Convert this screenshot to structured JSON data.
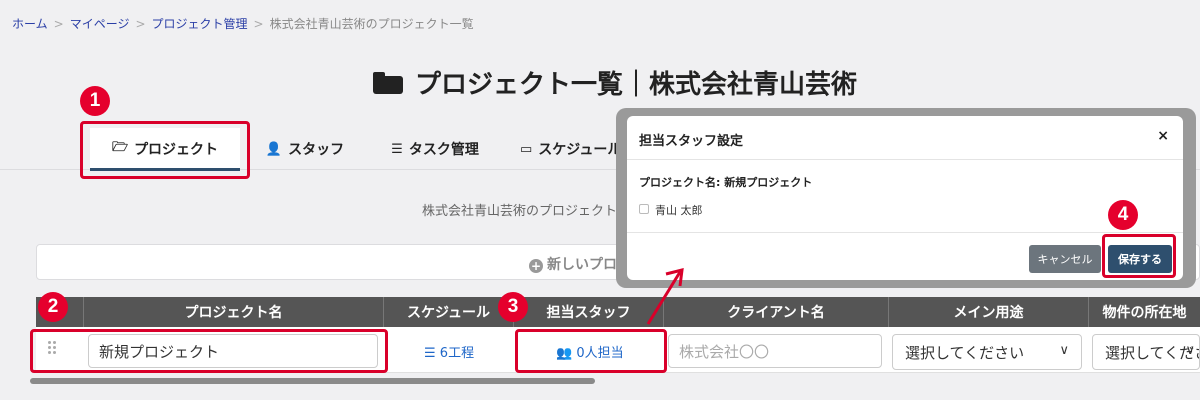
{
  "breadcrumb": {
    "items": [
      {
        "label": "ホーム",
        "link": true
      },
      {
        "label": "マイページ",
        "link": true
      },
      {
        "label": "プロジェクト管理",
        "link": true
      },
      {
        "label": "株式会社青山芸術のプロジェクト一覧",
        "link": false
      }
    ],
    "separator": ">"
  },
  "page_title": "プロジェクト一覧｜株式会社青山芸術",
  "tabs": [
    {
      "label": "プロジェクト",
      "icon": "folder-open-icon",
      "active": true
    },
    {
      "label": "スタッフ",
      "icon": "user-gear-icon",
      "active": false
    },
    {
      "label": "タスク管理",
      "icon": "list-check-icon",
      "active": false
    },
    {
      "label": "スケジュール",
      "icon": "calendar-icon",
      "active": false
    }
  ],
  "description": "株式会社青山芸術のプロジェクト",
  "new_project_button": "新しいプロジェ",
  "table": {
    "columns": [
      "プロジェクト名",
      "スケジュール",
      "担当スタッフ",
      "クライアント名",
      "メイン用途",
      "物件の所在地"
    ],
    "row": {
      "project_name": "新規プロジェクト",
      "schedule": "6工程",
      "staff": "0人担当",
      "client_placeholder": "株式会社〇〇",
      "usage": "選択してください",
      "location": "選択してくださ"
    }
  },
  "modal": {
    "title": "担当スタッフ設定",
    "close": "×",
    "project_label": "プロジェクト名: 新規プロジェクト",
    "staff_option": "青山 太郎",
    "cancel": "キャンセル",
    "save": "保存する"
  },
  "steps": [
    "1",
    "2",
    "3",
    "4"
  ],
  "colors": {
    "highlight": "#d9002a",
    "primary": "#2e4f6e",
    "link": "#1e66c8",
    "header_bg": "#555555"
  }
}
